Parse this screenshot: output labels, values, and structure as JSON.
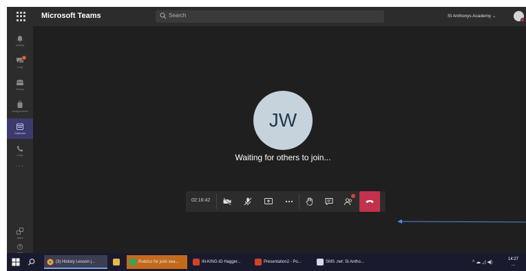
{
  "window": {
    "app_title": "Microsoft Teams",
    "search_placeholder": "Search",
    "org_name": "St Anthonys Academy",
    "org_chevron": "⌄"
  },
  "rail": {
    "items": [
      {
        "label": "Activity",
        "icon": "bell-icon"
      },
      {
        "label": "Chat",
        "icon": "chat-icon",
        "badge": "1"
      },
      {
        "label": "Teams",
        "icon": "teams-icon"
      },
      {
        "label": "Assignments",
        "icon": "backpack-icon"
      },
      {
        "label": "Calendar",
        "icon": "calendar-icon",
        "active": true
      },
      {
        "label": "Calls",
        "icon": "phone-icon"
      },
      {
        "label": "Apps",
        "icon": "apps-icon"
      },
      {
        "label": "Help",
        "icon": "help-icon"
      }
    ],
    "more": "···"
  },
  "call": {
    "initials": "JW",
    "status": "Waiting for others to join...",
    "timer": "02:16:42",
    "participants_badge": "1"
  },
  "colors": {
    "accent": "#6264a7",
    "hangup": "#c4314b",
    "arrow": "#4a8fe0"
  },
  "taskbar": {
    "apps": [
      {
        "label": "(3) History Lesson |..."
      },
      {
        "label": ""
      },
      {
        "label": "Rubrics for judo sea..."
      },
      {
        "label": "IN-KING-ID Hagger..."
      },
      {
        "label": "Presentation2 - Po..."
      },
      {
        "label": "SMS .net: St Antho..."
      }
    ],
    "tray": "^ ☁ ◿ ◀)",
    "time": "14:27",
    "date": "..."
  }
}
